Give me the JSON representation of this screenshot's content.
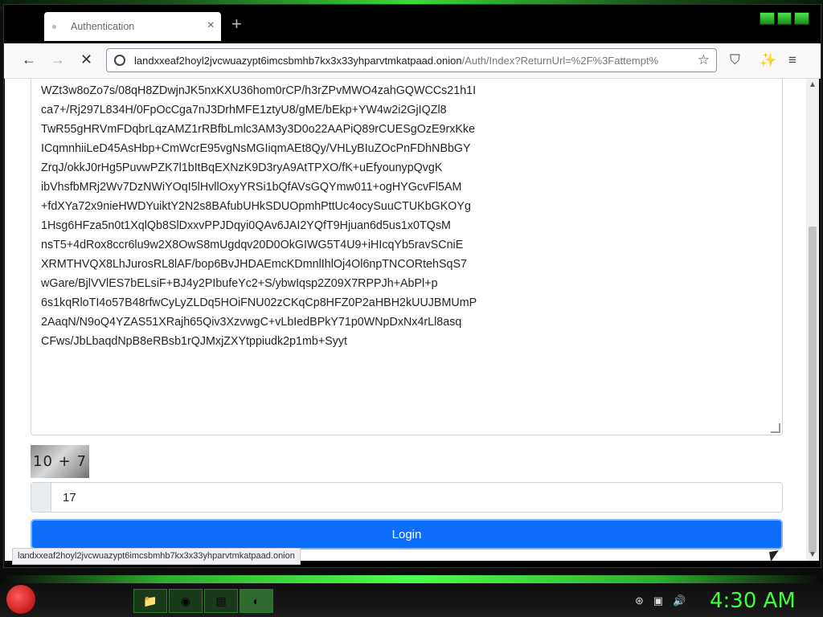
{
  "browser": {
    "tab_title": "Authentication",
    "tab_close": "×",
    "new_tab": "+",
    "url_host": "landxxeaf2hoyl2jvcwuazypt6imcsbmhb7kx3x33yhparvtmkatpaad.onion",
    "url_path": "/Auth/Index?ReturnUrl=%2F%3Fattempt%",
    "back": "←",
    "forward": "→",
    "stop": "✕",
    "star": "☆",
    "menu": "≡",
    "status_url": "landxxeaf2hoyl2jvcwuazypt6imcsbmhb7kx3x33yhparvtmkatpaad.onion"
  },
  "form": {
    "pgp_lines": [
      "WZt3w8oZo7s/08qH8ZDwjnJK5nxKXU36hom0rCP/h3rZPvMWO4zahGQWCCs21h1I",
      "ca7+/Rj297L834H/0FpOcCga7nJ3DrhMFE1ztyU8/gME/bEkp+YW4w2i2GjIQZl8",
      "TwR55gHRVmFDqbrLqzAMZ1rRBfbLmlc3AM3y3D0o22AAPiQ89rCUESgOzE9rxKke",
      "ICqmnhiiLeD45AsHbp+CmWcrE95vgNsMGIiqmAEt8Qy/VHLyBIuZOcPnFDhNBbGY",
      "ZrqJ/okkJ0rHg5PuvwPZK7l1bItBqEXNzK9D3ryA9AtTPXO/fK+uEfyounypQvgK",
      "ibVhsfbMRj2Wv7DzNWiYOqI5lHvllOxyYRSi1bQfAVsGQYmw011+ogHYGcvFl5AM",
      "+fdXYa72x9nieHWDYuiktY2N2s8BAfubUHkSDUOpmhPttUc4ocySuuCTUKbGKOYg",
      "1Hsg6HFza5n0t1XqlQb8SlDxxvPPJDqyi0QAv6JAI2YQfT9Hjuan6d5us1x0TQsM",
      "nsT5+4dRox8ccr6lu9w2X8OwS8mUgdqv20D0OkGIWG5T4U9+iHIcqYb5ravSCniE",
      "XRMTHVQX8LhJurosRL8lAF/bop6BvJHDAEmcKDmnlIhlOj4Ol6npTNCORtehSqS7",
      "wGare/BjlVVlES7bELsiF+BJ4y2PIbufeYc2+S/ybwIqsp2Z09X7RPPJh+AbPl+p",
      "6s1kqRloTI4o57B48rfwCyLyZLDq5HOiFNU02zCKqCp8HFZ0P2aHBH2kUUJBMUmP",
      "2AaqN/N9oQ4YZAS51XRajh65Qiv3XzvwgC+vLbIedBPkY71p0WNpDxNx4rLl8asq",
      "CFws/JbLbaqdNpB8eRBsb1rQJMxjZXYtppiudk2p1mb+Syyt"
    ],
    "captcha_text": "10 + 7",
    "captcha_answer": "17",
    "login_label": "Login"
  },
  "taskbar": {
    "clock": "4:30 AM"
  },
  "colors": {
    "primary_button": "#0d6efd",
    "clock_green": "#3cff3c"
  }
}
